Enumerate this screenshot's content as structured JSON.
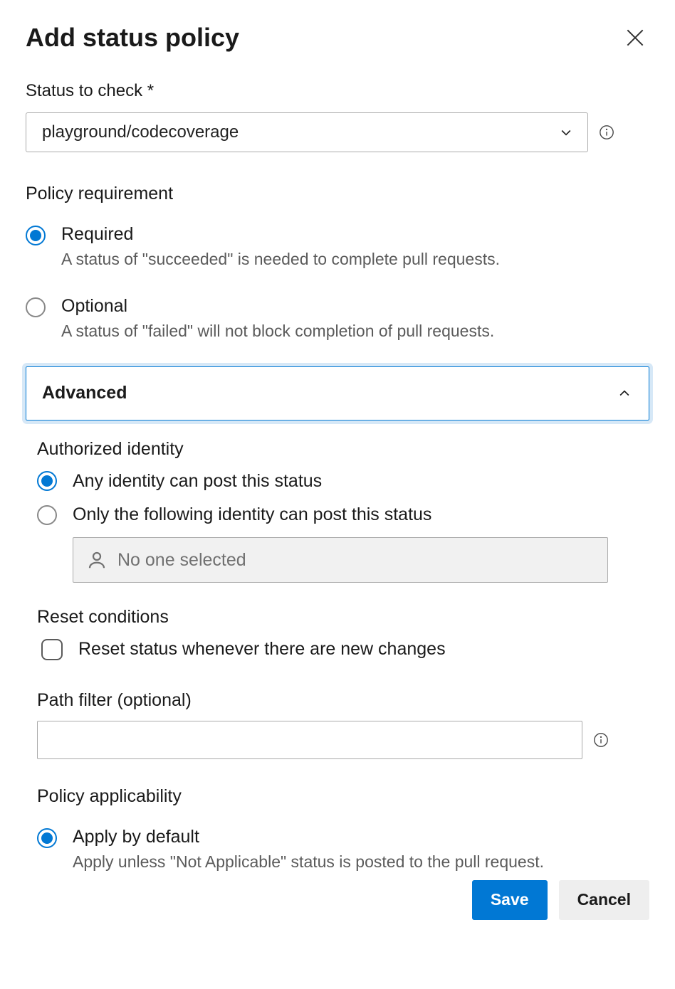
{
  "header": {
    "title": "Add status policy"
  },
  "status_to_check": {
    "label": "Status to check *",
    "value": "playground/codecoverage"
  },
  "policy_requirement": {
    "heading": "Policy requirement",
    "options": [
      {
        "label": "Required",
        "desc": "A status of \"succeeded\" is needed to complete pull requests.",
        "selected": true
      },
      {
        "label": "Optional",
        "desc": "A status of \"failed\" will not block completion of pull requests.",
        "selected": false
      }
    ]
  },
  "advanced": {
    "label": "Advanced",
    "expanded": true,
    "authorized_identity": {
      "heading": "Authorized identity",
      "options": [
        {
          "label": "Any identity can post this status",
          "selected": true
        },
        {
          "label": "Only the following identity can post this status",
          "selected": false
        }
      ],
      "picker_placeholder": "No one selected"
    },
    "reset_conditions": {
      "heading": "Reset conditions",
      "checkbox_label": "Reset status whenever there are new changes",
      "checked": false
    },
    "path_filter": {
      "label": "Path filter (optional)",
      "value": ""
    },
    "policy_applicability": {
      "heading": "Policy applicability",
      "options": [
        {
          "label": "Apply by default",
          "desc": "Apply unless \"Not Applicable\" status is posted to the pull request.",
          "selected": true
        }
      ]
    }
  },
  "buttons": {
    "save": "Save",
    "cancel": "Cancel"
  }
}
